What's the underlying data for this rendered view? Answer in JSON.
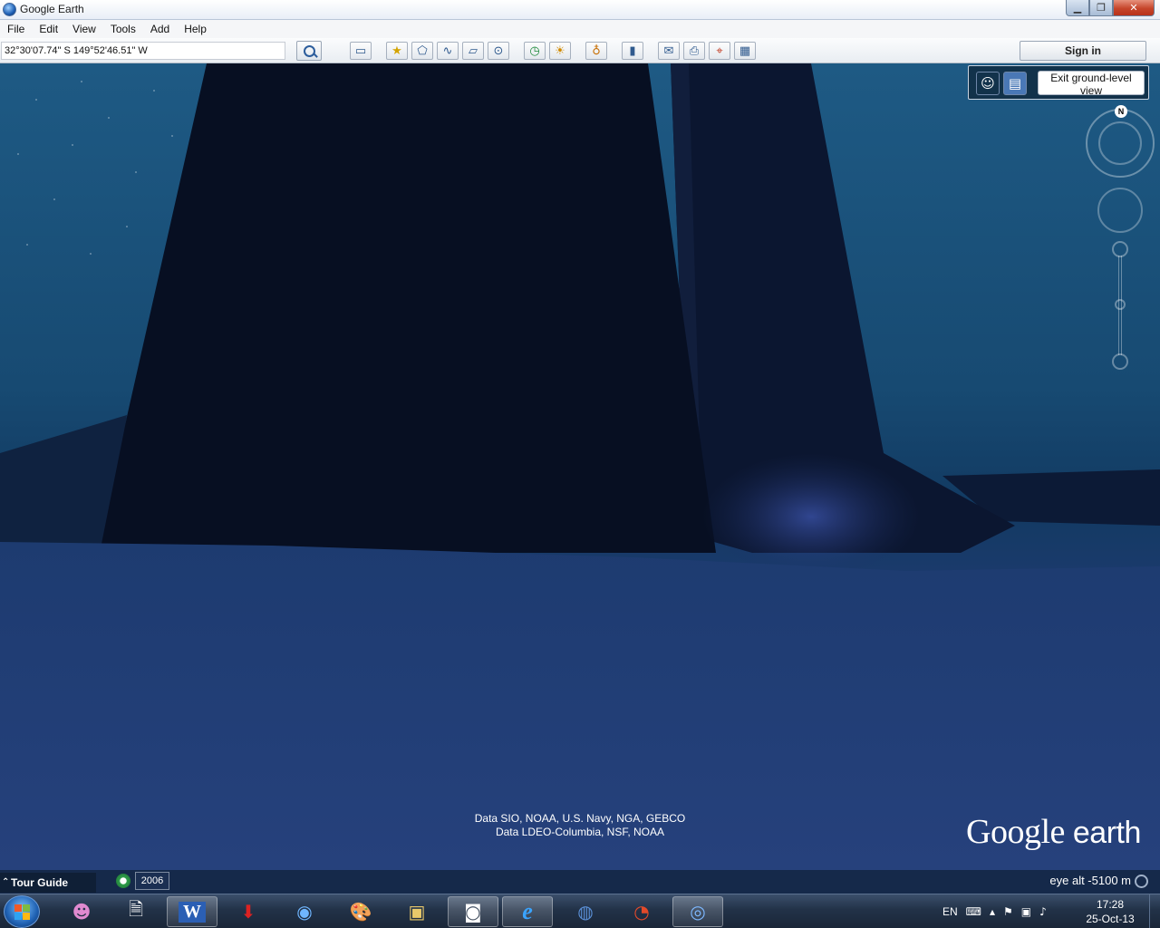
{
  "window": {
    "title": "Google Earth"
  },
  "menu": [
    "File",
    "Edit",
    "View",
    "Tools",
    "Add",
    "Help"
  ],
  "toolbar": {
    "coordinates": "32°30'07.74\" S 149°52'46.51\" W",
    "sign_in": "Sign in",
    "icons": [
      "sidebar-icon",
      "placemark-icon",
      "polygon-icon",
      "path-icon",
      "overlay-icon",
      "record-tour-icon",
      "historical-imagery-icon",
      "sunlight-icon",
      "planets-icon",
      "ruler-icon",
      "email-icon",
      "print-icon",
      "google-maps-icon",
      "gallery-icon"
    ]
  },
  "navigation": {
    "exit_ground_level": "Exit ground-level view",
    "compass_north": "N"
  },
  "attribution": [
    "Data SIO, NOAA, U.S. Navy, NGA, GEBCO",
    "Data LDEO-Columbia, NSF, NOAA"
  ],
  "logo": {
    "google": "Google",
    "earth": "earth"
  },
  "status": {
    "tour_guide": "Tour Guide",
    "year": "2006",
    "eye_alt": "eye alt  -5100 m"
  },
  "taskbar": {
    "apps": [
      "ie-icon",
      "word-icon",
      "downloader-icon",
      "teamviewer-icon",
      "paint-icon",
      "explorer-icon",
      "camera-icon",
      "internet-explorer-icon",
      "globe-icon",
      "ccleaner-icon",
      "google-earth-icon"
    ],
    "language": "EN",
    "time": "17:28",
    "date": "25-Oct-13"
  },
  "colors": {
    "sea_floor": "#233f79",
    "water": "#1e5a84",
    "ridge": "#0a1428"
  }
}
